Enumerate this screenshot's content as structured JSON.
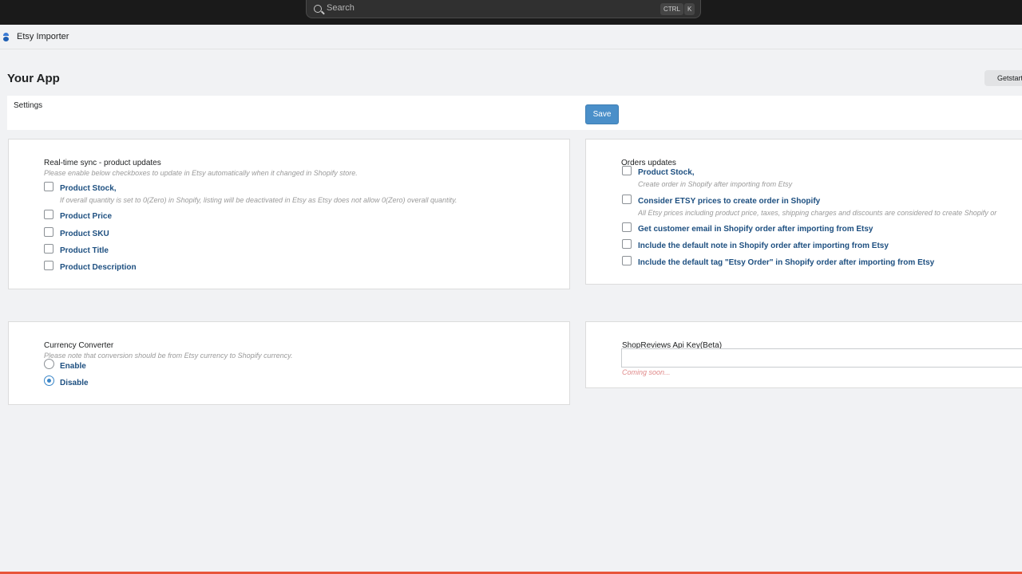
{
  "topbar": {
    "search_placeholder": "Search",
    "shortcut_keys": [
      "CTRL",
      "K"
    ]
  },
  "app": {
    "name": "Etsy Importer"
  },
  "page": {
    "title": "Your App",
    "getstarted_label": "Getstarte",
    "settings_label": "Settings",
    "save_label": "Save"
  },
  "realtime_sync": {
    "title": "Real-time sync - product updates",
    "hint": "Please enable below checkboxes to update in Etsy automatically when it changed in Shopify store.",
    "options": [
      {
        "label": "Product Stock,",
        "hint": "If overall quantity is set to 0(Zero) in Shopify, listing will be deactivated in Etsy as Etsy does not allow 0(Zero) overall quantity.",
        "checked": false
      },
      {
        "label": "Product Price",
        "checked": false
      },
      {
        "label": "Product SKU",
        "checked": false
      },
      {
        "label": "Product Title",
        "checked": false
      },
      {
        "label": "Product Description",
        "checked": false
      }
    ]
  },
  "orders_updates": {
    "title": "Orders updates",
    "options": [
      {
        "label": "Product Stock,",
        "hint": "Create order in Shopify after importing from Etsy",
        "checked": false
      },
      {
        "label": "Consider ETSY prices to create order in Shopify",
        "hint": "All Etsy prices including product price, taxes, shipping charges and discounts are considered to create Shopify or",
        "checked": false
      },
      {
        "label": "Get customer email in Shopify order after importing from Etsy",
        "checked": false
      },
      {
        "label": "Include the default note in Shopify order after importing from Etsy",
        "checked": false
      },
      {
        "label": "Include the default tag \"Etsy Order\" in Shopify order after importing from Etsy",
        "checked": false
      }
    ]
  },
  "currency_converter": {
    "title": "Currency Converter",
    "hint": "Please note that conversion should be from Etsy currency to Shopify currency.",
    "options": [
      {
        "label": "Enable",
        "selected": false
      },
      {
        "label": "Disable",
        "selected": true
      }
    ]
  },
  "shopreviews": {
    "title": "ShopReviews Api Key(Beta)",
    "value": "",
    "status": "Coming soon..."
  },
  "colors": {
    "accent": "#4a8fc9",
    "option_text": "#1d4f80",
    "topbar": "#1a1a1a"
  }
}
